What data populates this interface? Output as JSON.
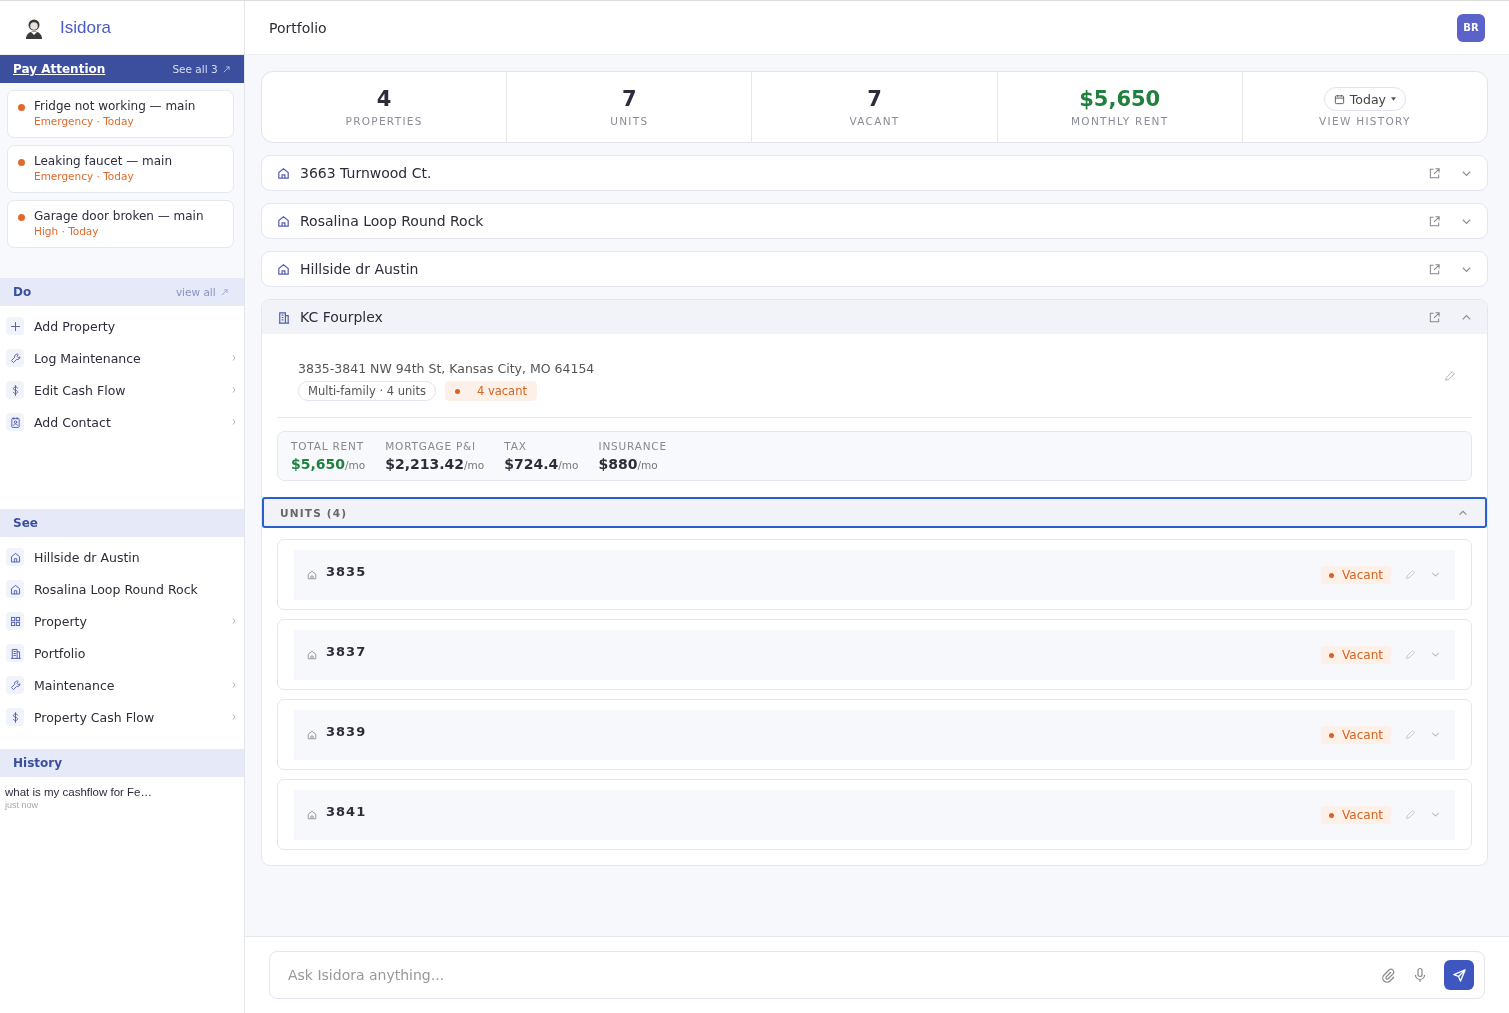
{
  "brand": {
    "name": "Isidora"
  },
  "header": {
    "title": "Portfolio",
    "avatar": "BR"
  },
  "attention": {
    "title": "Pay Attention",
    "link": "See all 3",
    "items": [
      {
        "title": "Fridge not working — main",
        "meta": "Emergency · Today",
        "color": "#e06a2c"
      },
      {
        "title": "Leaking faucet — main",
        "meta": "Emergency · Today",
        "color": "#e06a2c"
      },
      {
        "title": "Garage door broken — main",
        "meta": "High · Today",
        "color": "#e06a2c"
      }
    ]
  },
  "do": {
    "title": "Do",
    "link": "view all",
    "items": [
      {
        "label": "Add Property",
        "kind": "plus",
        "chevron": false
      },
      {
        "label": "Log Maintenance",
        "kind": "wrench",
        "chevron": true
      },
      {
        "label": "Edit Cash Flow",
        "kind": "dollar",
        "chevron": true
      },
      {
        "label": "Add Contact",
        "kind": "contact",
        "chevron": true
      }
    ]
  },
  "see": {
    "title": "See",
    "items": [
      {
        "label": "Hillside dr Austin",
        "kind": "house",
        "chevron": false
      },
      {
        "label": "Rosalina Loop Round Rock",
        "kind": "house",
        "chevron": false
      },
      {
        "label": "Property",
        "kind": "grid",
        "chevron": true
      },
      {
        "label": "Portfolio",
        "kind": "building",
        "chevron": false
      },
      {
        "label": "Maintenance",
        "kind": "wrench",
        "chevron": true
      },
      {
        "label": "Property Cash Flow",
        "kind": "dollar",
        "chevron": true
      }
    ]
  },
  "history": {
    "title": "History",
    "items": [
      {
        "text": "what is my cashflow for Fe…",
        "time": "just now"
      }
    ]
  },
  "stats": [
    {
      "value": "4",
      "label": "PROPERTIES",
      "kind": "plain"
    },
    {
      "value": "7",
      "label": "UNITS",
      "kind": "plain"
    },
    {
      "value": "7",
      "label": "VACANT",
      "kind": "plain"
    },
    {
      "value": "$5,650",
      "label": "MONTHLY RENT",
      "kind": "money"
    },
    {
      "value": "Today",
      "label": "VIEW HISTORY",
      "kind": "picker"
    }
  ],
  "properties": [
    {
      "name": "3663 Turnwood Ct.",
      "kind": "house",
      "expanded": false
    },
    {
      "name": "Rosalina Loop Round Rock",
      "kind": "house",
      "expanded": false
    },
    {
      "name": "Hillside dr Austin",
      "kind": "house",
      "expanded": false
    },
    {
      "name": "KC Fourplex",
      "kind": "building",
      "expanded": true,
      "address": "3835-3841 NW 94th St, Kansas City, MO 64154",
      "tags": [
        {
          "text": "Multi-family · 4 units",
          "kind": "plain"
        },
        {
          "text": "4 vacant",
          "kind": "alert"
        }
      ],
      "finance": [
        {
          "label": "TOTAL RENT",
          "value": "$5,650",
          "unit": "/mo",
          "kind": "money"
        },
        {
          "label": "MORTGAGE P&I",
          "value": "$2,213.42",
          "unit": "/mo",
          "kind": "plain"
        },
        {
          "label": "TAX",
          "value": "$724.4",
          "unit": "/mo",
          "kind": "plain"
        },
        {
          "label": "INSURANCE",
          "value": "$880",
          "unit": "/mo",
          "kind": "plain"
        }
      ],
      "units_title": "UNITS (4)",
      "units": [
        {
          "number": "3835",
          "status": "Vacant"
        },
        {
          "number": "3837",
          "status": "Vacant"
        },
        {
          "number": "3839",
          "status": "Vacant"
        },
        {
          "number": "3841",
          "status": "Vacant"
        }
      ]
    }
  ],
  "chat": {
    "placeholder": "Ask Isidora anything..."
  }
}
